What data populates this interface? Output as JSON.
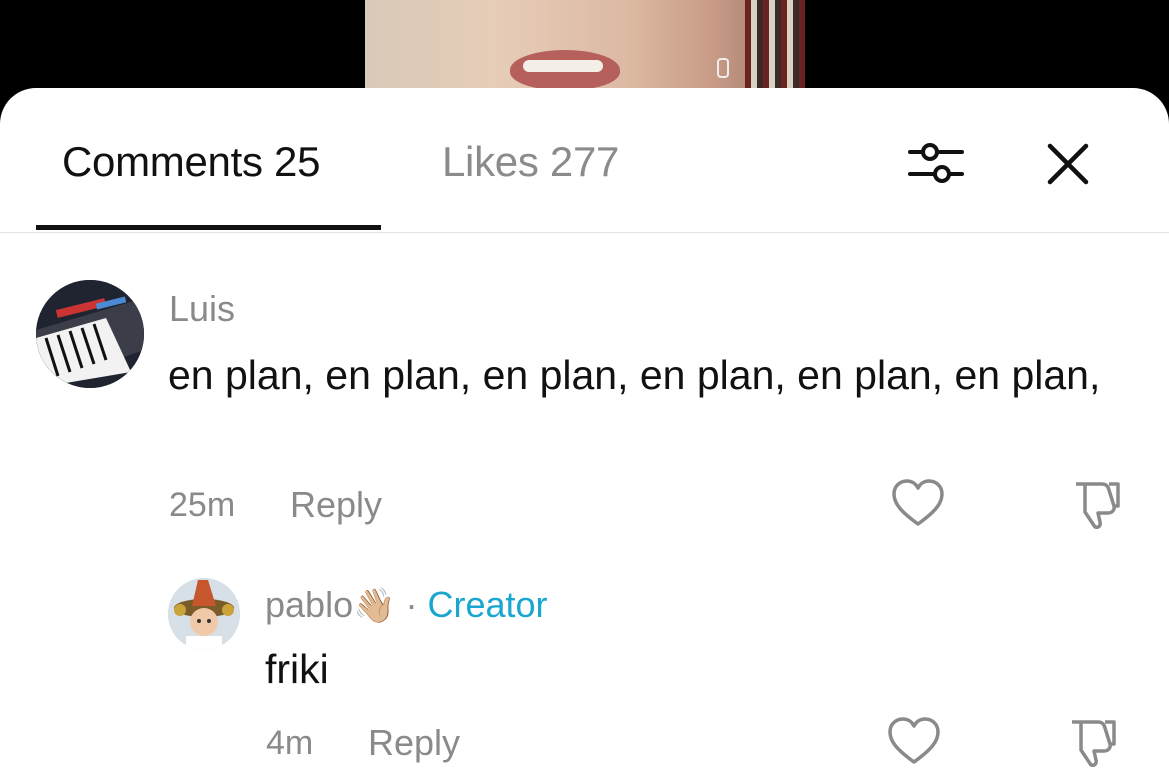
{
  "tabs": {
    "comments_label": "Comments 25",
    "likes_label": "Likes 277"
  },
  "icons": {
    "filter": "sliders-icon",
    "close": "close-icon",
    "like": "heart-icon",
    "dislike": "thumbs-down-icon"
  },
  "comments": [
    {
      "username": "Luis",
      "text": "en plan, en plan, en plan, en plan, en plan, en plan,",
      "time": "25m",
      "reply_label": "Reply",
      "avatar": "synthesizer-keyboard"
    }
  ],
  "replies": [
    {
      "username": "pablo",
      "emoji": "👋🏼",
      "separator": "·",
      "badge": "Creator",
      "text": "friki",
      "time": "4m",
      "reply_label": "Reply",
      "avatar": "child-in-wizard-hat"
    }
  ],
  "colors": {
    "accent_creator": "#1aa7cf",
    "muted": "#8a8a8a",
    "text": "#111111"
  }
}
